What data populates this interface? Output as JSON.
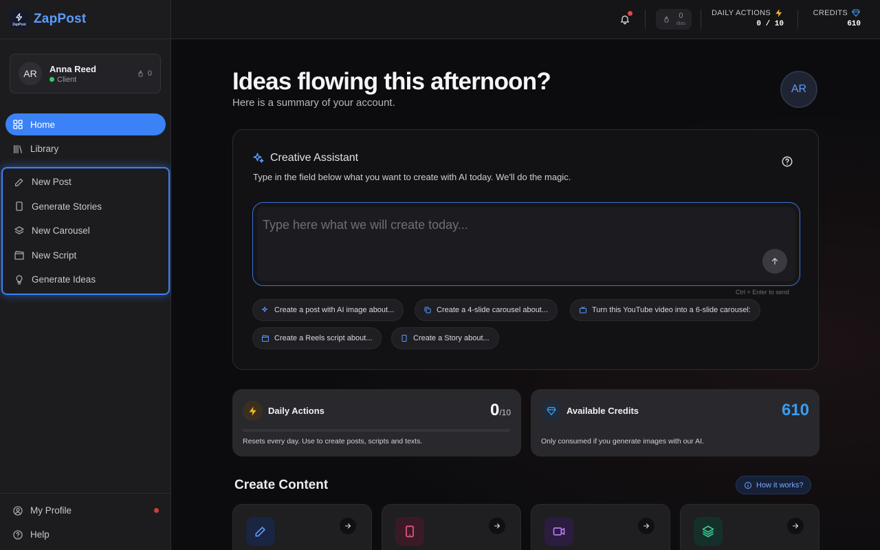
{
  "brand": {
    "name": "ZapPost",
    "logo_text": "ZapPost"
  },
  "user": {
    "initials": "AR",
    "name": "Anna Reed",
    "role": "Client",
    "streak": "0"
  },
  "nav": {
    "home": "Home",
    "library": "Library",
    "new_post": "New Post",
    "generate_stories": "Generate Stories",
    "new_carousel": "New Carousel",
    "new_script": "New Script",
    "generate_ideas": "Generate Ideas"
  },
  "bottom_nav": {
    "profile": "My Profile",
    "help": "Help"
  },
  "topbar": {
    "streak_value": "0",
    "streak_unit": "dias",
    "daily_actions_label": "DAILY ACTIONS",
    "daily_actions_value": "0 / 10",
    "credits_label": "CREDITS",
    "credits_value": "610"
  },
  "main": {
    "headline": "Ideas flowing this afternoon?",
    "subline": "Here is a summary of your account.",
    "avatar_initials": "AR"
  },
  "assistant": {
    "title": "Creative Assistant",
    "description": "Type in the field below what you want to create with AI today. We'll do the magic.",
    "placeholder": "Type here what we will create today...",
    "hint": "Ctrl + Enter to send",
    "chips": [
      "Create a post with AI image about...",
      "Create a 4-slide carousel about...",
      "Turn this YouTube video into a 6-slide carousel:",
      "Create a Reels script about...",
      "Create a Story about..."
    ]
  },
  "stats": {
    "daily": {
      "title": "Daily Actions",
      "value": "0",
      "max": "/10",
      "note": "Resets every day. Use to create posts, scripts and texts.",
      "progress": 0
    },
    "credits": {
      "title": "Available Credits",
      "value": "610",
      "note": "Only consumed if you generate images with our AI."
    }
  },
  "create_content": {
    "title": "Create Content",
    "how_label": "How it works?"
  },
  "colors": {
    "accent": "#3a82f6",
    "credits": "#3b9cf0",
    "warning": "#f5b623"
  }
}
